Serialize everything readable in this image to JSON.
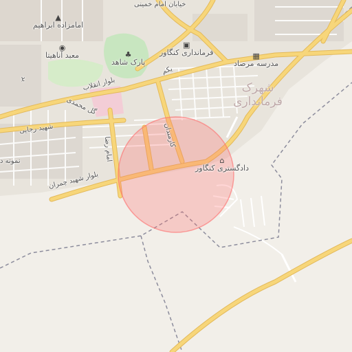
{
  "labels": {
    "street_imam": "خیابان امام خمینی",
    "shrine": "امامزاده ابراهیم",
    "temple": "معبد آناهیتا",
    "park": "پارک شاهد",
    "governorate": "فرمانداری کنگاور",
    "school": "مدرسه مرصاد",
    "district": "شهرک فرمانداری",
    "blvd_enghelab": "بلوار انقلاب",
    "street_golmohammadi": "گل محمدی",
    "street_rajaei": "شهید رجایی",
    "street_emamreza": "امام رضا",
    "street_karmandan": "کارمندان",
    "street_yekom": "یکم",
    "courthouse": "دادگستری کنگاور",
    "blvd_chamran": "بلوار شهید چمران",
    "edge_left": "نمونه د",
    "street_left": "بد"
  },
  "icons": {
    "shrine": "mosque-icon",
    "temple": "camera-icon",
    "park": "tree-icon",
    "governorate": "government-building-icon",
    "school": "school-icon",
    "courthouse": "courthouse-icon"
  },
  "colors": {
    "background": "#f2efe9",
    "road_major": "#f7d67a",
    "road_minor": "#ffffff",
    "park": "#c8e6c0",
    "boundary": "#8c8c9c",
    "highlight_circle": "#ff6a6a"
  }
}
